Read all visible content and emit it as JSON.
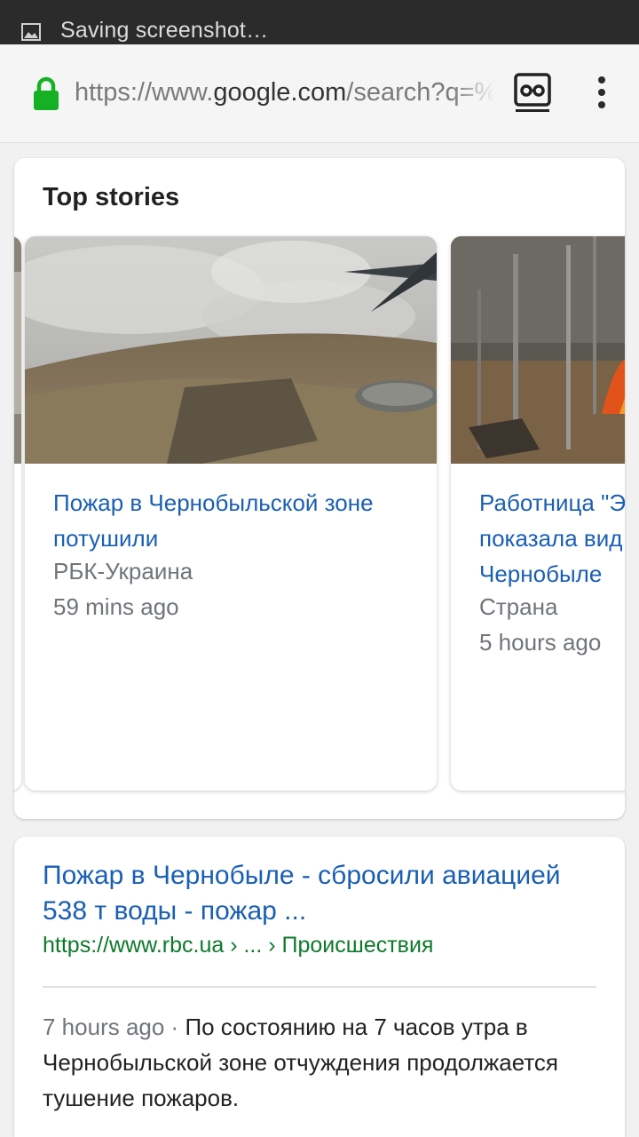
{
  "status_bar": {
    "notification_text": "Saving screenshot…",
    "notification_icon": "image-icon"
  },
  "url_bar": {
    "url_prefix": "https://www.",
    "url_host": "google.com",
    "url_rest": "/search?q=%",
    "lock_color": "#16b024",
    "icons": [
      "lock-icon",
      "incognito-tab-icon",
      "overflow-menu-icon"
    ]
  },
  "top_stories": {
    "title": "Top stories",
    "stories": [
      {
        "headline": "Пожар в Чернобыльской зоне потушили",
        "source": "РБК-Украина",
        "time": "59 mins ago",
        "image": "aerial-smoke-over-forest"
      },
      {
        "headline": "Работница \"Эн показала вид Чернобыле",
        "headline_lines": [
          "Работница \"Эн",
          "показала вид",
          "Чернобыле"
        ],
        "source": "Страна",
        "time": "5 hours ago",
        "image": "forest-fire-flames"
      }
    ]
  },
  "result": {
    "title": "Пожар в Чернобыле - сбросили авиацией 538 т воды - пожар ...",
    "url": "https://www.rbc.ua › ... › Происшествия",
    "age": "7 hours ago",
    "separator": " · ",
    "snippet": "По состоянию на 7 часов утра в Чернобыльской зоне отчуждения продолжается тушение пожаров."
  }
}
